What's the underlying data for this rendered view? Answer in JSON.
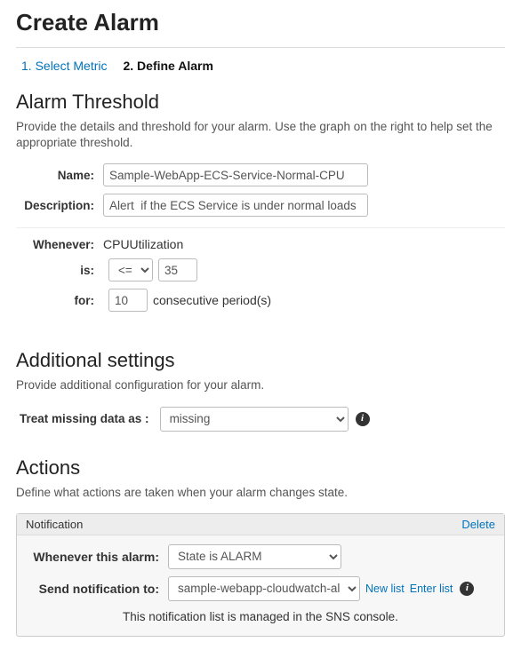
{
  "page": {
    "title": "Create Alarm"
  },
  "steps": {
    "step1": "1. Select Metric",
    "step2": "2. Define Alarm"
  },
  "threshold": {
    "title": "Alarm Threshold",
    "desc": "Provide the details and threshold for your alarm. Use the graph on the right to help set the appropriate threshold.",
    "labels": {
      "name": "Name:",
      "description": "Description:",
      "whenever": "Whenever:",
      "is": "is:",
      "for": "for:"
    },
    "name_value": "Sample-WebApp-ECS-Service-Normal-CPU",
    "description_value": "Alert  if the ECS Service is under normal loads",
    "whenever_metric": "CPUUtilization",
    "is_operator": "<=",
    "is_value": "35",
    "for_value": "10",
    "for_suffix": "consecutive period(s)"
  },
  "additional": {
    "title": "Additional settings",
    "desc": "Provide additional configuration for your alarm.",
    "treat_missing_label": "Treat missing data as :",
    "treat_missing_value": "missing"
  },
  "actions": {
    "title": "Actions",
    "desc": "Define what actions are taken when your alarm changes state.",
    "notification": {
      "header": "Notification",
      "delete": "Delete",
      "whenever_label": "Whenever this alarm:",
      "whenever_value": "State is ALARM",
      "send_to_label": "Send notification to:",
      "send_to_value": "sample-webapp-cloudwatch-alerts",
      "new_list": "New list",
      "enter_list": "Enter list",
      "managed_note": "This notification list is managed in the SNS console."
    }
  }
}
